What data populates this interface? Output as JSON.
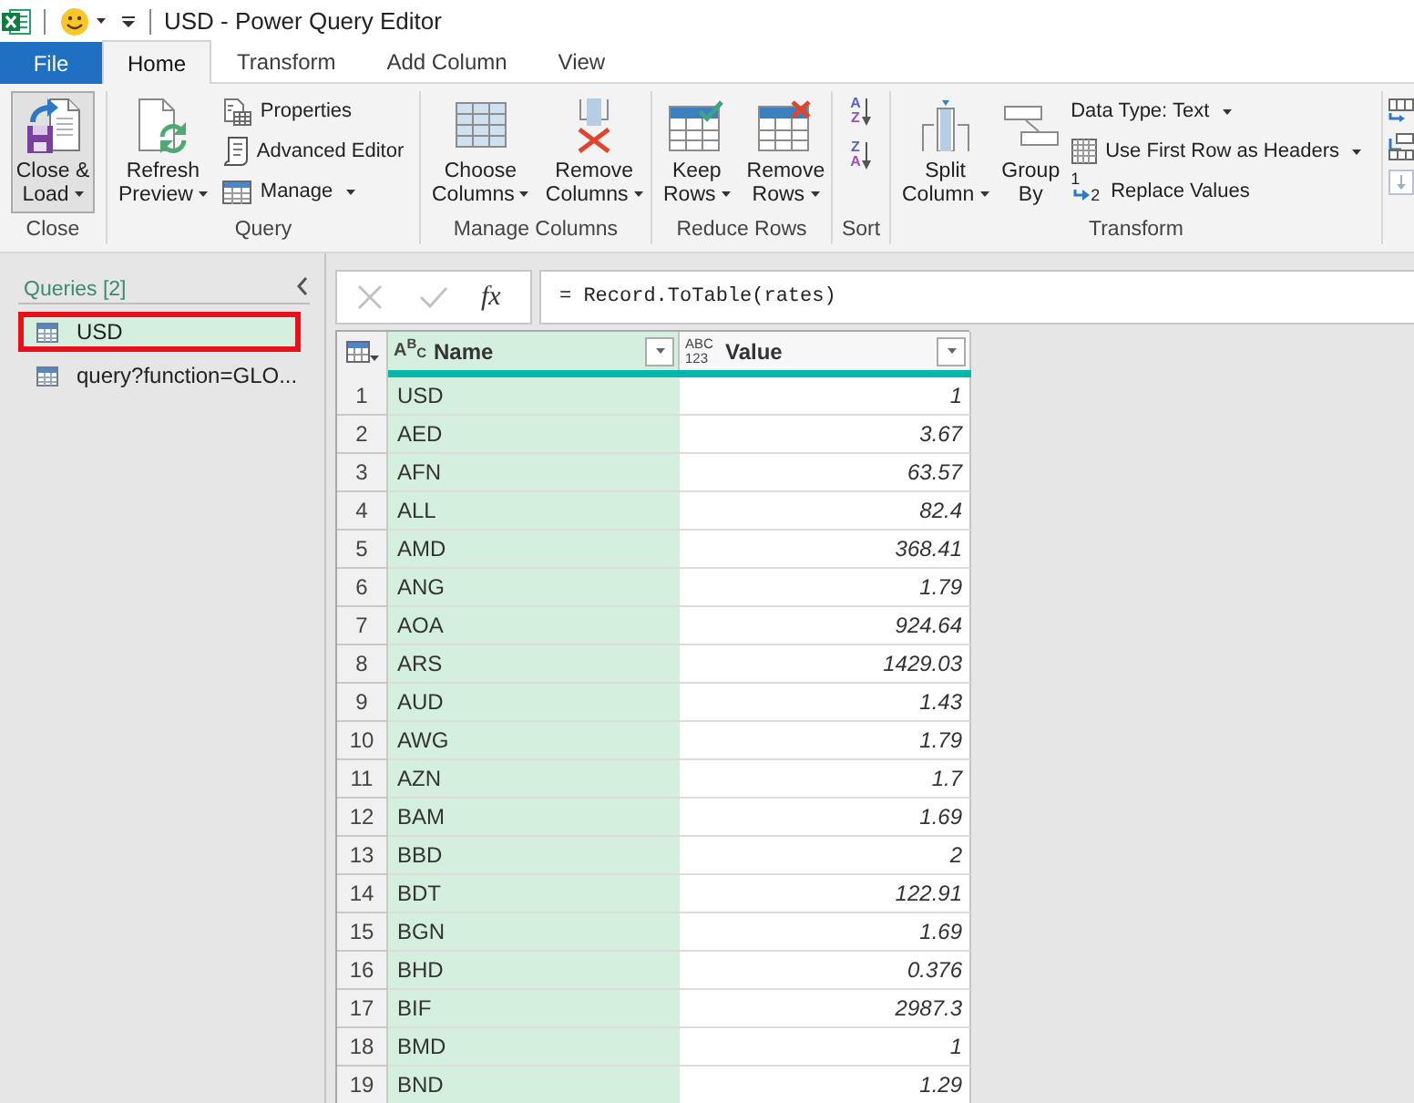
{
  "window": {
    "title": "USD - Power Query Editor"
  },
  "ribbon_tabs": [
    {
      "label": "File",
      "kind": "file",
      "selected": false
    },
    {
      "label": "Home",
      "kind": "tab",
      "selected": true
    },
    {
      "label": "Transform",
      "kind": "tab",
      "selected": false
    },
    {
      "label": "Add Column",
      "kind": "tab",
      "selected": false
    },
    {
      "label": "View",
      "kind": "tab",
      "selected": false
    }
  ],
  "ribbon_groups": [
    {
      "label": "Close",
      "items": [
        {
          "kind": "large",
          "label": "Close &\nLoad",
          "dropdown": true,
          "pressed": true
        }
      ]
    },
    {
      "label": "Query",
      "items": [
        {
          "kind": "large",
          "label": "Refresh\nPreview",
          "dropdown": true,
          "pressed": false
        },
        {
          "kind": "small",
          "label": "Properties",
          "dropdown": false,
          "pressed": false
        },
        {
          "kind": "small",
          "label": "Advanced Editor",
          "dropdown": false,
          "pressed": false
        },
        {
          "kind": "small",
          "label": "Manage",
          "dropdown": true,
          "pressed": false
        }
      ]
    },
    {
      "label": "Manage Columns",
      "items": [
        {
          "kind": "large",
          "label": "Choose\nColumns",
          "dropdown": true,
          "pressed": false
        },
        {
          "kind": "large",
          "label": "Remove\nColumns",
          "dropdown": true,
          "pressed": false
        }
      ]
    },
    {
      "label": "Reduce Rows",
      "items": [
        {
          "kind": "large",
          "label": "Keep\nRows",
          "dropdown": true,
          "pressed": false
        },
        {
          "kind": "large",
          "label": "Remove\nRows",
          "dropdown": true,
          "pressed": false
        }
      ]
    },
    {
      "label": "Sort",
      "items": [
        {
          "kind": "sort",
          "letters": [
            "A",
            "Z"
          ],
          "pressed": false
        },
        {
          "kind": "sort",
          "letters": [
            "Z",
            "A"
          ],
          "pressed": false
        }
      ]
    },
    {
      "label": "Transform",
      "items": [
        {
          "kind": "large",
          "label": "Split\nColumn",
          "dropdown": true,
          "pressed": false
        },
        {
          "kind": "large",
          "label": "Group\nBy",
          "dropdown": false,
          "pressed": false
        },
        {
          "kind": "small",
          "label": "Data Type: Text",
          "dropdown": true,
          "pressed": false
        },
        {
          "kind": "small",
          "label": "Use First Row as Headers",
          "dropdown": true,
          "pressed": false
        },
        {
          "kind": "small",
          "label": "Replace Values",
          "dropdown": false,
          "pressed": false,
          "icon_glyphs": [
            "1",
            "2"
          ]
        }
      ]
    }
  ],
  "queries_pane": {
    "title": "Queries [2]",
    "items": [
      {
        "label": "USD",
        "selected": true,
        "highlighted": true
      },
      {
        "label": "query?function=GLO...",
        "selected": false,
        "highlighted": false
      }
    ]
  },
  "formula_bar": {
    "buttons": [
      {
        "kind": "cancel",
        "disabled": true
      },
      {
        "kind": "commit",
        "disabled": true
      },
      {
        "kind": "function",
        "label": "fx",
        "disabled": false
      }
    ],
    "formula": "= Record.ToTable(rates)"
  },
  "table": {
    "columns": [
      {
        "name": "Name",
        "type_icon": [
          "A$^{B}$$_{C}$"
        ],
        "kind": "text",
        "selected": true,
        "level": 1
      },
      {
        "name": "Value",
        "type_icon": [
          "ABC",
          "123"
        ],
        "kind": "any",
        "selected": false,
        "level": 1
      }
    ],
    "rows": [
      {
        "number": "1",
        "cells": [
          "USD",
          "1"
        ]
      },
      {
        "number": "2",
        "cells": [
          "AED",
          "3.67"
        ]
      },
      {
        "number": "3",
        "cells": [
          "AFN",
          "63.57"
        ]
      },
      {
        "number": "4",
        "cells": [
          "ALL",
          "82.4"
        ]
      },
      {
        "number": "5",
        "cells": [
          "AMD",
          "368.41"
        ]
      },
      {
        "number": "6",
        "cells": [
          "ANG",
          "1.79"
        ]
      },
      {
        "number": "7",
        "cells": [
          "AOA",
          "924.64"
        ]
      },
      {
        "number": "8",
        "cells": [
          "ARS",
          "1429.03"
        ]
      },
      {
        "number": "9",
        "cells": [
          "AUD",
          "1.43"
        ]
      },
      {
        "number": "10",
        "cells": [
          "AWG",
          "1.79"
        ]
      },
      {
        "number": "11",
        "cells": [
          "AZN",
          "1.7"
        ]
      },
      {
        "number": "12",
        "cells": [
          "BAM",
          "1.69"
        ]
      },
      {
        "number": "13",
        "cells": [
          "BBD",
          "2"
        ]
      },
      {
        "number": "14",
        "cells": [
          "BDT",
          "122.91"
        ]
      },
      {
        "number": "15",
        "cells": [
          "BGN",
          "1.69"
        ]
      },
      {
        "number": "16",
        "cells": [
          "BHD",
          "0.376"
        ]
      },
      {
        "number": "17",
        "cells": [
          "BIF",
          "2987.3"
        ]
      },
      {
        "number": "18",
        "cells": [
          "BMD",
          "1"
        ]
      },
      {
        "number": "19",
        "cells": [
          "BND",
          "1.29"
        ]
      }
    ]
  }
}
